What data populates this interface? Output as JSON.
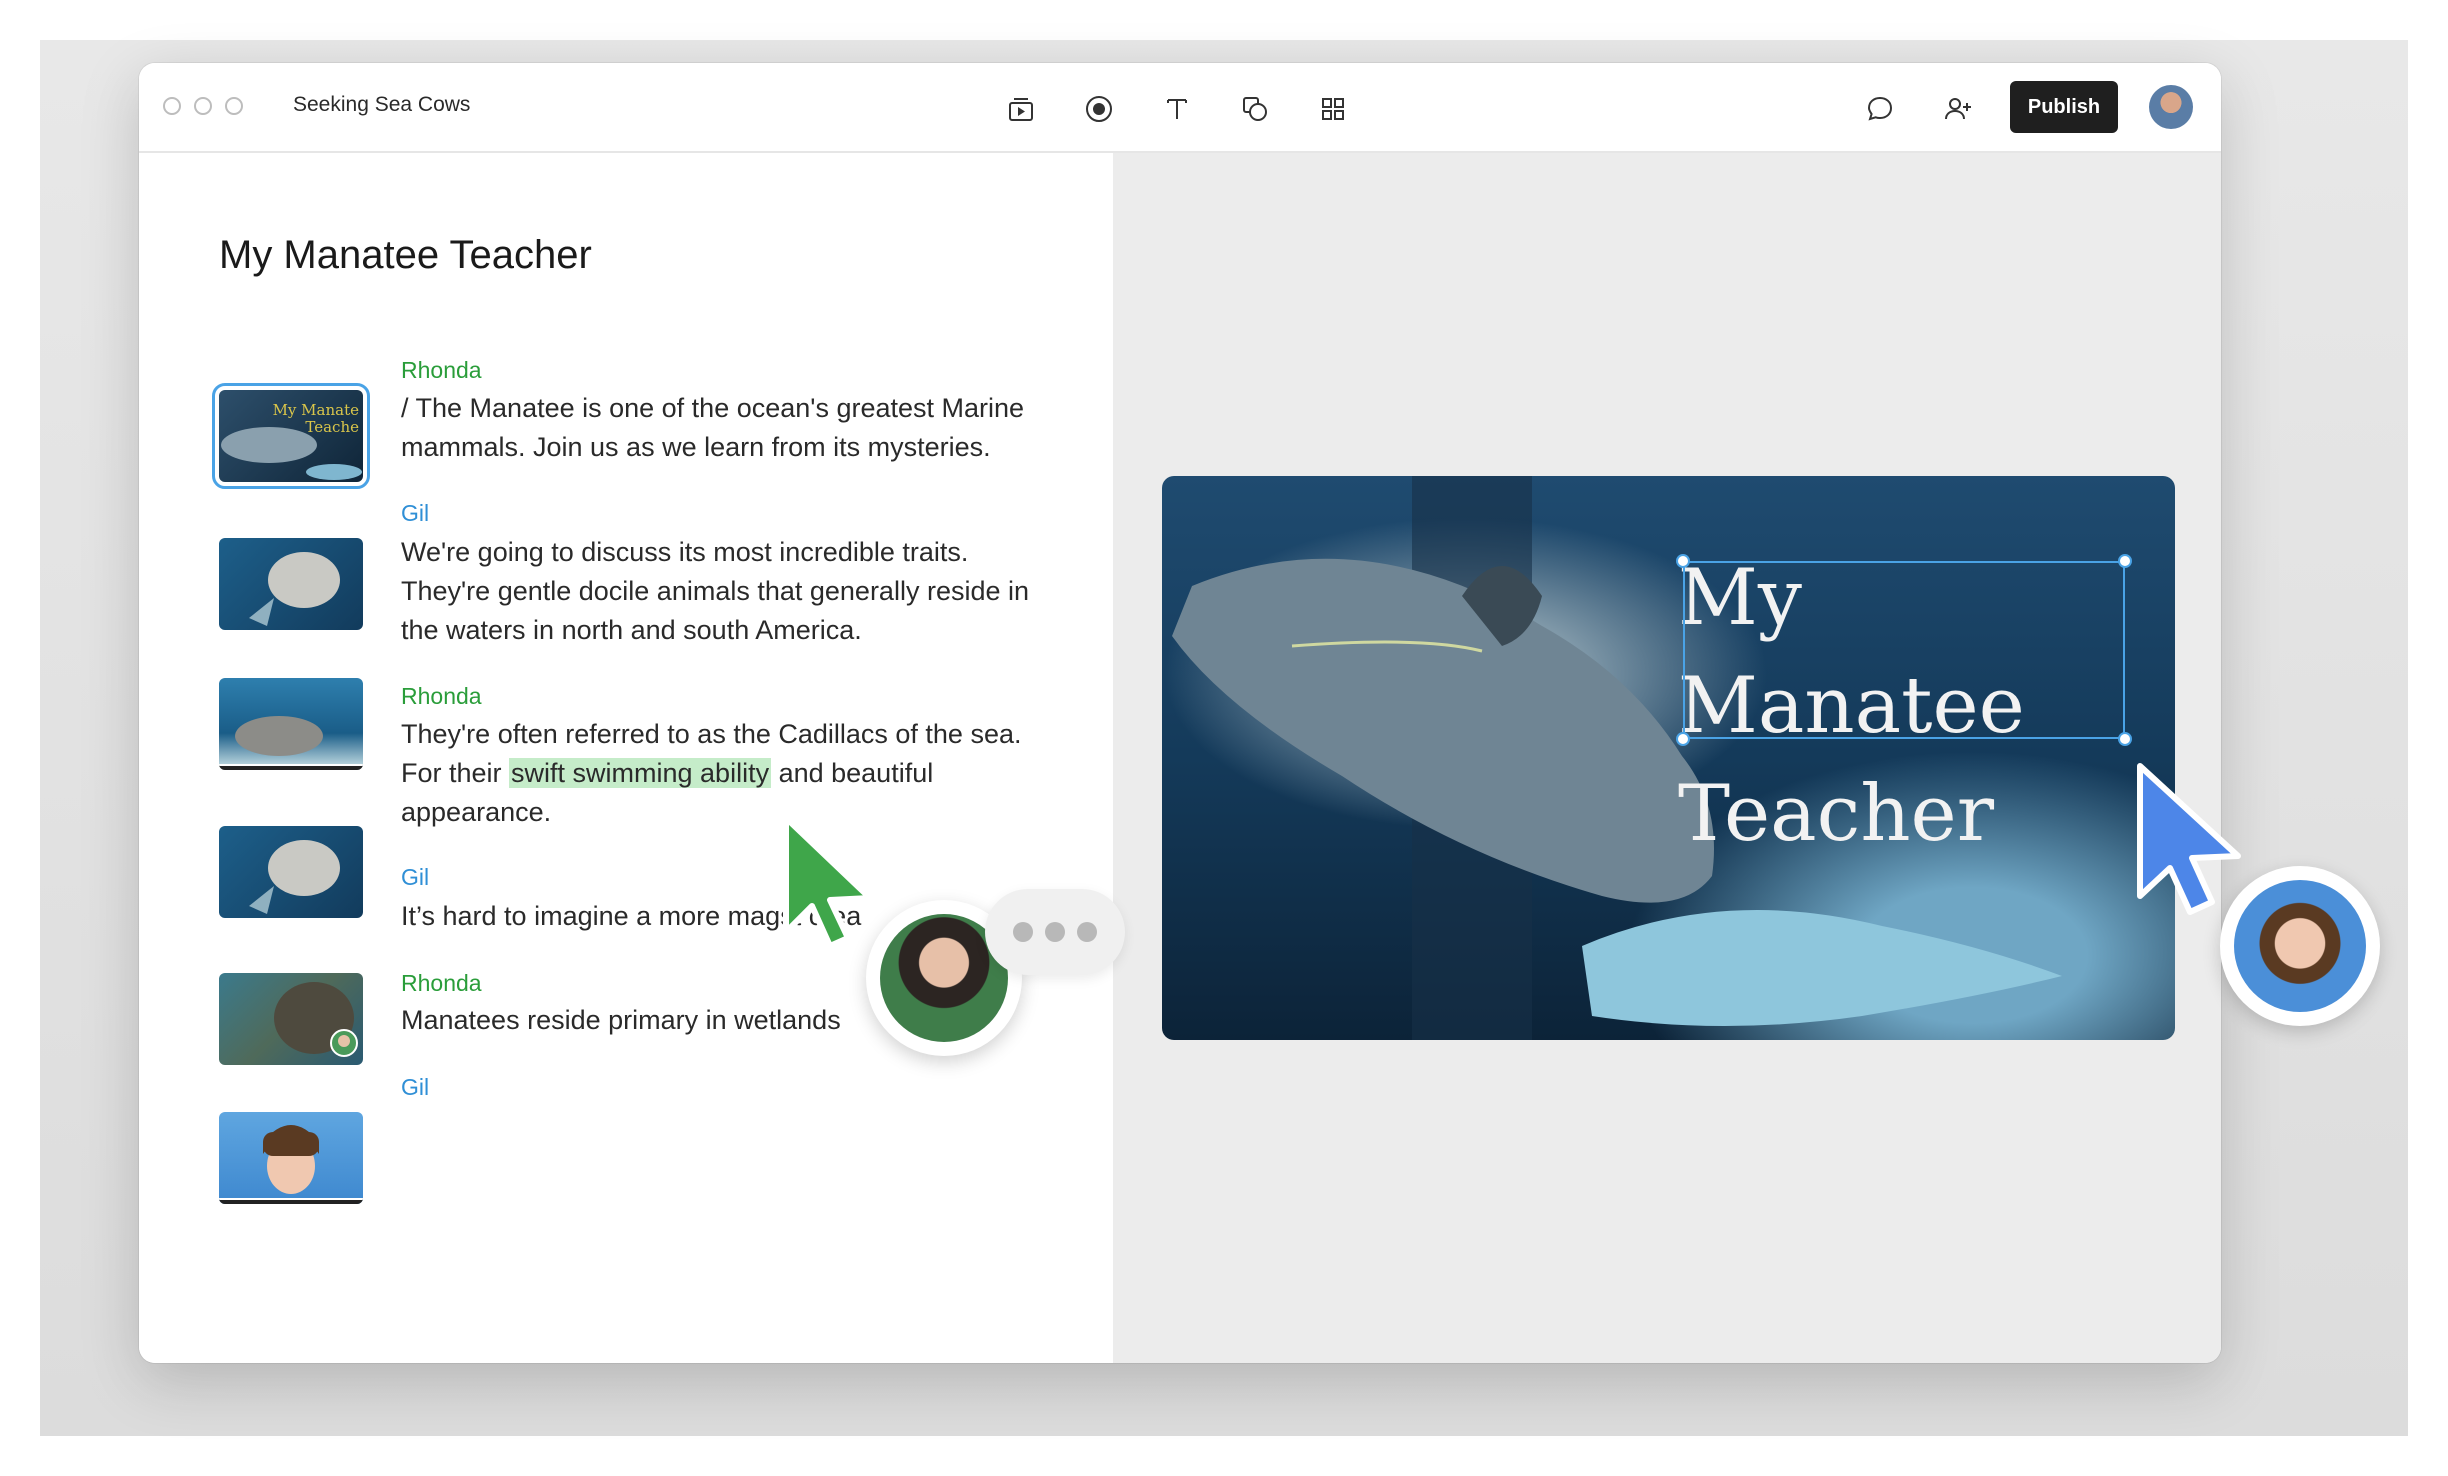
{
  "window": {
    "title": "Seeking Sea Cows"
  },
  "toolbar": {
    "tools": [
      "media-insert-icon",
      "record-icon",
      "text-icon",
      "shapes-icon",
      "grid-icon"
    ],
    "right": [
      "comment-icon",
      "add-user-icon"
    ],
    "publish_label": "Publish"
  },
  "script": {
    "title": "My Manatee Teacher",
    "blocks": [
      {
        "speaker": "Rhonda",
        "text": "/ The Manatee is one of the ocean's greatest Marine mammals. Join us as we learn from its mysteries."
      },
      {
        "speaker": "Gil",
        "text": "We're going to discuss its most incredible traits. They're gentle docile animals that generally reside in the waters in north and south America."
      },
      {
        "speaker": "Rhonda",
        "text_before": "They're often referred to as the Cadillacs of the sea. For their ",
        "highlight": "swift swimming ability",
        "text_after": " and beautiful appearance."
      },
      {
        "speaker": "Gil",
        "text": "It’s hard to imagine a more mag"
      },
      {
        "speaker": "Rhonda",
        "text": "Manatees reside primary in wetlands"
      },
      {
        "speaker": "Gil",
        "text": ""
      }
    ],
    "partial_text": "st   crea"
  },
  "canvas": {
    "title_line1": "My Manatee",
    "title_line2": "Teacher"
  },
  "thumb_overlay": {
    "line1": "My Manate",
    "line2": "Teache"
  },
  "colors": {
    "rhonda": "#2a9d3a",
    "gil": "#2f8fd6",
    "selection": "#4aa3e6",
    "publish_bg": "#1f1f1f"
  }
}
